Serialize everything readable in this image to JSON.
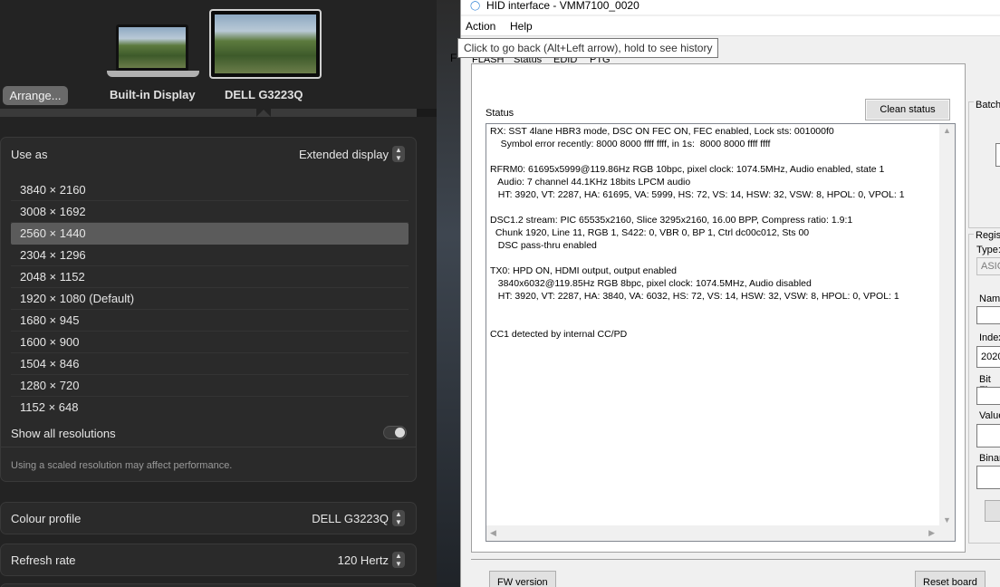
{
  "mac": {
    "arrange_label": "Arrange...",
    "displays": [
      "Built-in Display",
      "DELL G3223Q"
    ],
    "use_as": {
      "label": "Use as",
      "value": "Extended display"
    },
    "resolutions": [
      "3840 × 2160",
      "3008 × 1692",
      "2560 × 1440",
      "2304 × 1296",
      "2048 × 1152",
      "1920 × 1080 (Default)",
      "1680 × 945",
      "1600 × 900",
      "1504 × 846",
      "1280 × 720",
      "1152 × 648"
    ],
    "selected_resolution": "2560 × 1440",
    "show_all": {
      "label": "Show all resolutions",
      "enabled": false
    },
    "note": "Using a scaled resolution may affect performance.",
    "colour_profile": {
      "label": "Colour profile",
      "value": "DELL G3223Q"
    },
    "refresh_rate": {
      "label": "Refresh rate",
      "value": "120 Hertz"
    }
  },
  "win": {
    "title": "HID interface - VMM7100_0020",
    "menu": [
      "Action",
      "Help"
    ],
    "tooltip": "Click to go back (Alt+Left arrow), hold to see history",
    "tabs": [
      "FLASH",
      "Status",
      "EDID",
      "PTG output"
    ],
    "f_char": "F",
    "status_label": "Status",
    "clean_status_button": "Clean status",
    "status_lines": [
      "RX: SST 4lane HBR3 mode, DSC ON FEC ON, FEC enabled, Lock sts: 001000f0",
      "    Symbol error recently: 8000 8000 ffff ffff, in 1s:  8000 8000 ffff ffff",
      "",
      "RFRM0: 61695x5999@119.86Hz RGB 10bpc, pixel clock: 1074.5MHz, Audio enabled, state 1",
      "   Audio: 7 channel 44.1KHz 18bits LPCM audio",
      "   HT: 3920, VT: 2287, HA: 61695, VA: 5999, HS: 72, VS: 14, HSW: 32, VSW: 8, HPOL: 0, VPOL: 1",
      "",
      "DSC1.2 stream: PIC 65535x2160, Slice 3295x2160, 16.00 BPP, Compress ratio: 1.9:1",
      "  Chunk 1920, Line 11, RGB 1, S422: 0, VBR 0, BP 1, Ctrl dc00c012, Sts 00",
      "   DSC pass-thru enabled",
      "",
      "TX0: HPD ON, HDMI output, output enabled",
      "   3840x6032@119.85Hz RGB 8bpc, pixel clock: 1074.5MHz, Audio disabled",
      "   HT: 3920, VT: 2287, HA: 3840, VA: 6032, HS: 72, VS: 14, HSW: 32, VSW: 8, HPOL: 0, VPOL: 1",
      "",
      "",
      "CC1 detected by internal CC/PD"
    ],
    "bottom_buttons": [
      "FW version",
      "Reset board"
    ],
    "side": {
      "batch_label": "Batch",
      "regis_label": "Regis",
      "type_label": "Type:",
      "type_value": "ASIC",
      "name_label": "Name",
      "index_label": "Index",
      "index_value": "2020",
      "bitfield_label": "Bit Fi",
      "value_label": "Value",
      "binary_label": "Binar"
    }
  }
}
